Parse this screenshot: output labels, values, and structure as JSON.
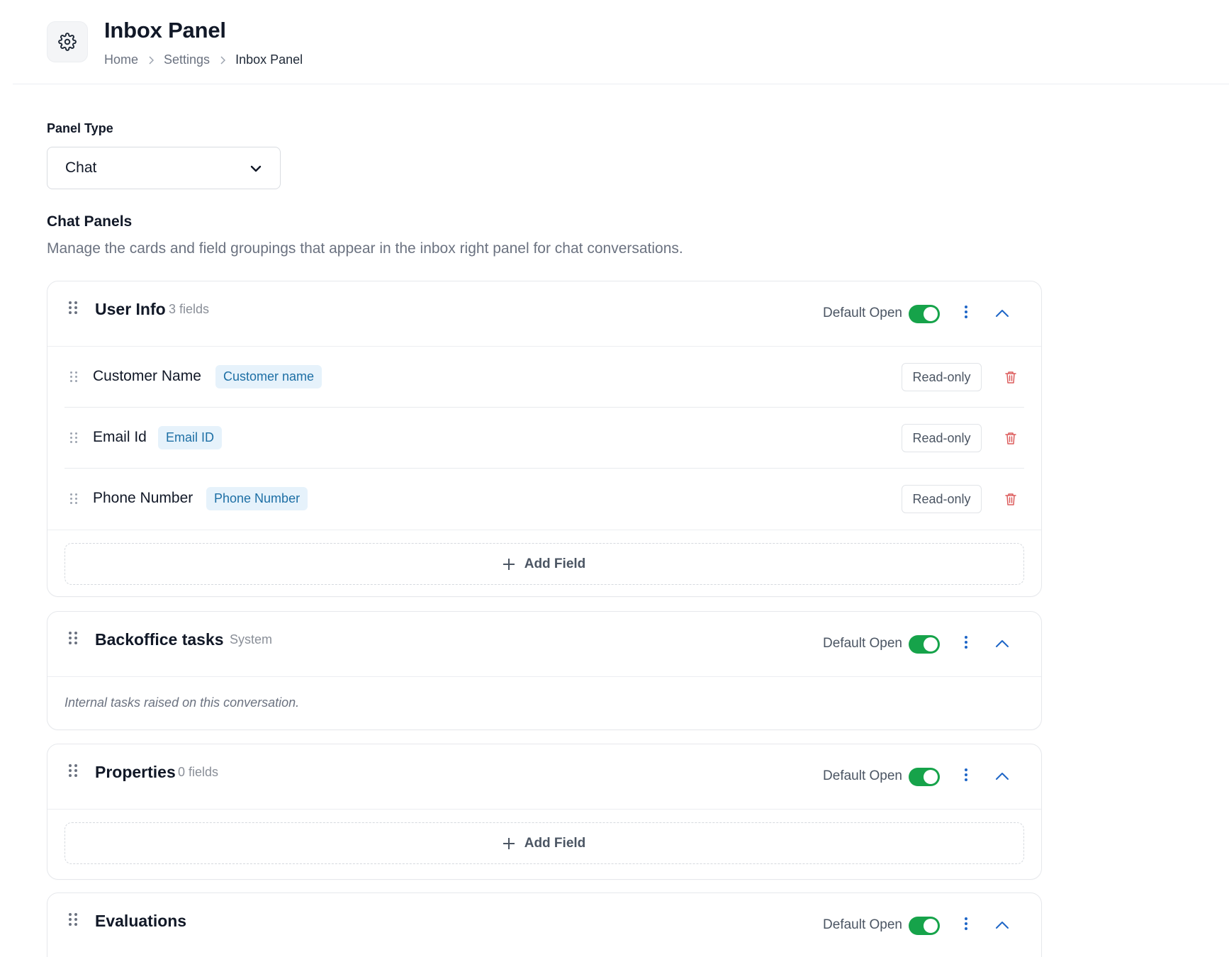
{
  "header": {
    "title": "Inbox Panel",
    "icon": "gear-icon",
    "breadcrumb": [
      "Home",
      "Settings",
      "Inbox Panel"
    ]
  },
  "panel_type": {
    "label": "Panel Type",
    "selected": "Chat"
  },
  "section": {
    "title": "Chat Panels",
    "description": "Manage the cards and field groupings that appear in the inbox right panel for chat conversations."
  },
  "cards": [
    {
      "title": "User Info",
      "meta": "3 fields",
      "default_open_label": "Default Open",
      "default_open": true,
      "fields": [
        {
          "name": "Customer Name",
          "tag": "Customer name",
          "mode": "Read-only"
        },
        {
          "name": "Email Id",
          "tag": "Email ID",
          "mode": "Read-only"
        },
        {
          "name": "Phone Number",
          "tag": "Phone Number",
          "mode": "Read-only"
        }
      ],
      "add_label": "Add Field"
    },
    {
      "title": "Backoffice tasks",
      "meta": "System",
      "default_open_label": "Default Open",
      "default_open": true,
      "description": "Internal tasks raised on this conversation."
    },
    {
      "title": "Properties",
      "meta": "0 fields",
      "default_open_label": "Default Open",
      "default_open": true,
      "add_label": "Add Field"
    },
    {
      "title": "Evaluations",
      "default_open_label": "Default Open",
      "default_open": true
    }
  ],
  "colors": {
    "toggle_on": "#16a34a",
    "accent_blue": "#1e66c7",
    "tag_bg": "#e6f2fb",
    "tag_text": "#1d6fa5",
    "danger": "#dc5b5b"
  }
}
